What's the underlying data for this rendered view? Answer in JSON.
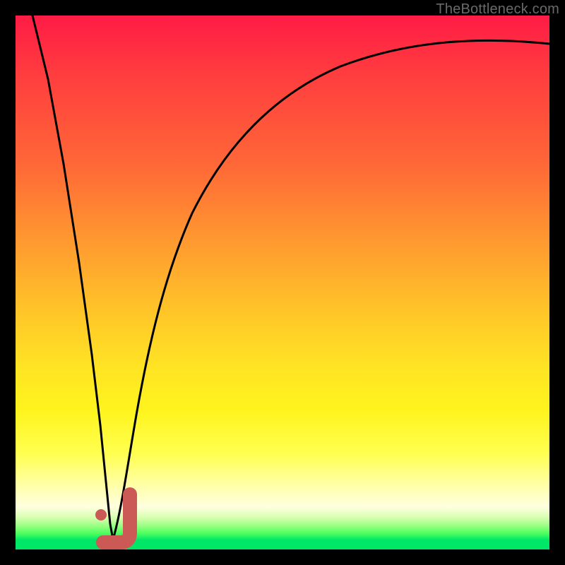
{
  "attribution": "TheBottleneck.com",
  "colors": {
    "gradient_top": "#ff1b45",
    "gradient_mid": "#ffe424",
    "gradient_bottom": "#00e768",
    "curve": "#000000",
    "marker": "#cb5a57",
    "frame": "#000000"
  },
  "chart_data": {
    "type": "line",
    "title": "",
    "xlabel": "",
    "ylabel": "",
    "xlim": [
      0,
      100
    ],
    "ylim": [
      0,
      100
    ],
    "note": "Bottleneck-style curve: y≈100 (red) means large mismatch, y≈0 (green) means balanced. Minimum near x≈17.",
    "series": [
      {
        "name": "left-branch",
        "x": [
          3,
          5,
          7,
          9,
          11,
          13,
          15,
          16,
          17
        ],
        "y": [
          100,
          88,
          76,
          64,
          52,
          40,
          24,
          12,
          2
        ]
      },
      {
        "name": "right-branch",
        "x": [
          17,
          18,
          19,
          20,
          22,
          25,
          30,
          35,
          40,
          50,
          60,
          70,
          80,
          90,
          100
        ],
        "y": [
          2,
          6,
          12,
          20,
          34,
          50,
          65,
          74,
          79,
          85,
          88.5,
          90.5,
          92,
          93,
          93.8
        ]
      }
    ],
    "marker": {
      "x": 15.5,
      "y": 4,
      "glyph": "J"
    }
  }
}
